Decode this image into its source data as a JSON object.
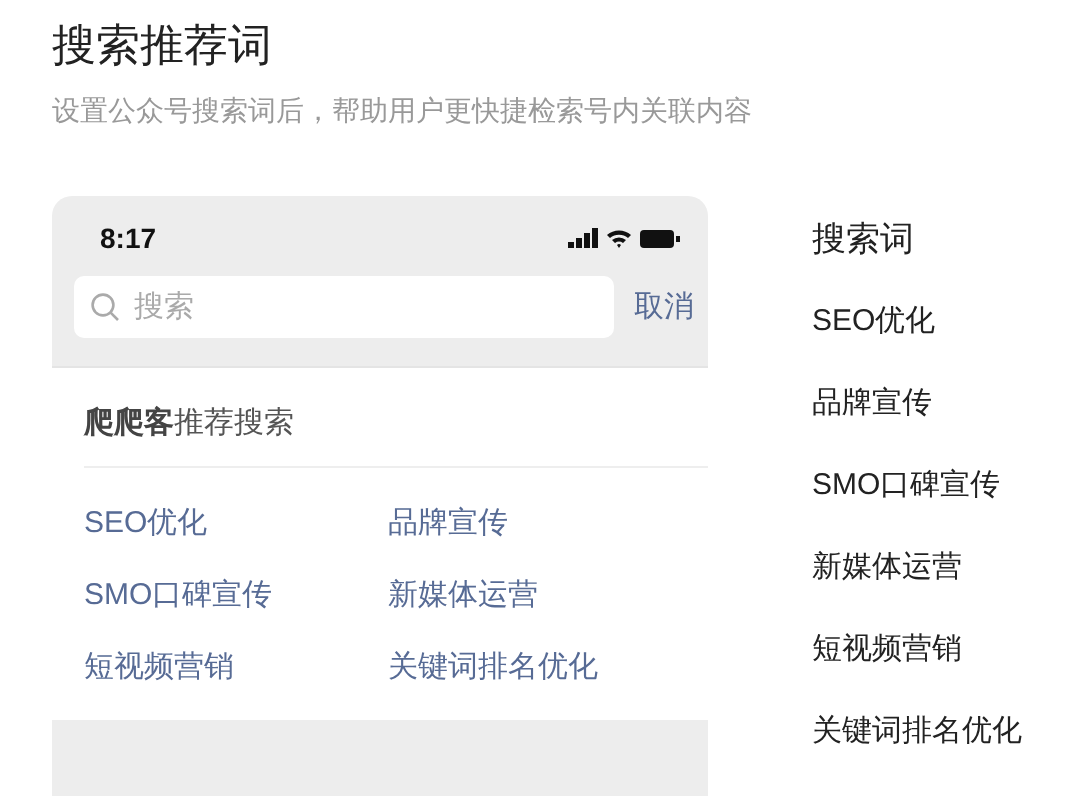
{
  "header": {
    "title": "搜索推荐词",
    "subtitle": "设置公众号搜索词后，帮助用户更快捷检索号内关联内容"
  },
  "phone": {
    "time": "8:17",
    "search": {
      "placeholder": "搜索"
    },
    "cancel": "取消",
    "section_title": "**爬爬客**推荐搜索",
    "keywords": [
      "SEO优化",
      "品牌宣传",
      "SMO口碑宣传",
      "新媒体运营",
      "短视频营销",
      "关键词排名优化"
    ]
  },
  "keyword_list": {
    "title": "搜索词",
    "items": [
      "SEO优化",
      "品牌宣传",
      "SMO口碑宣传",
      "新媒体运营",
      "短视频营销",
      "关键词排名优化"
    ]
  }
}
